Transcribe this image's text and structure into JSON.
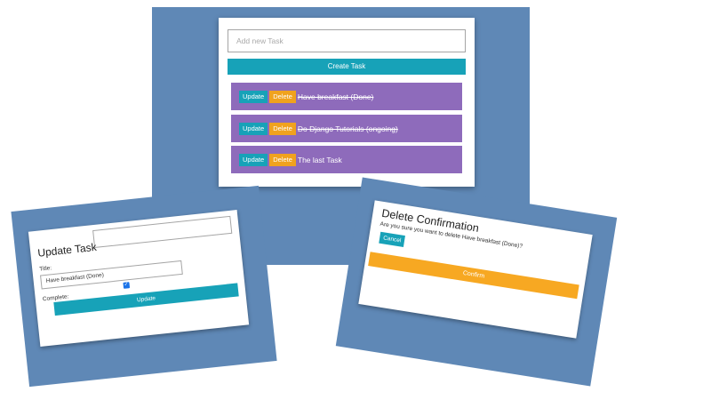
{
  "task_list": {
    "input_placeholder": "Add new Task",
    "create_button": "Create Task",
    "tasks": [
      {
        "update_label": "Update",
        "delete_label": "Delete",
        "title": "Have breakfast (Done)",
        "completed": true
      },
      {
        "update_label": "Update",
        "delete_label": "Delete",
        "title": "Do Django Tutorials (ongoing)",
        "completed": true
      },
      {
        "update_label": "Update",
        "delete_label": "Delete",
        "title": "The last Task",
        "completed": false
      }
    ]
  },
  "update_modal": {
    "heading": "Update Task",
    "title_label": "Title:",
    "title_value": "Have breakfast (Done)",
    "complete_label": "Complete:",
    "complete_checked": true,
    "submit_button": "Update"
  },
  "delete_modal": {
    "heading": "Delete Confirmation",
    "question": "Are you sure you want to delete Have breakfast (Done)?",
    "cancel_button": "Cancel",
    "confirm_button": "Confirm"
  },
  "colors": {
    "background_panel": "#5f88b6",
    "task_row": "#8e6bbb",
    "info_button": "#17a2b8",
    "warning_button": "#f0a21e"
  }
}
